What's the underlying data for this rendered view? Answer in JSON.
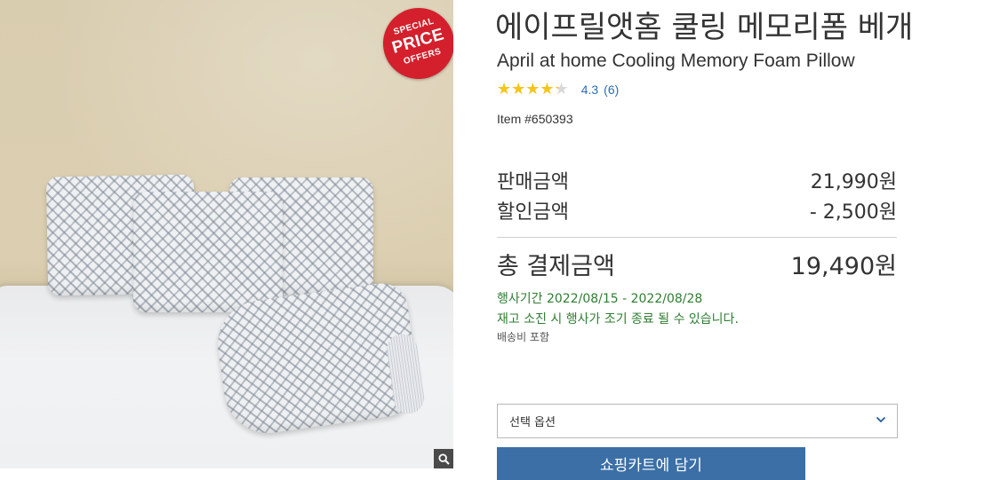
{
  "product": {
    "title_ko": "에이프릴앳홈 쿨링 메모리폼 베개",
    "title_en": "April at home Cooling Memory Foam Pillow",
    "rating_value": "4.3",
    "rating_fraction": 0.86,
    "review_count": "(6)",
    "item_number": "Item #650393",
    "image": {
      "badge": {
        "line1": "SPECIAL",
        "line2": "PRICE",
        "line3": "OFFERS"
      },
      "zoom_icon": "magnifier-icon"
    }
  },
  "price": {
    "sale_label": "판매금액",
    "sale_value": "21,990원",
    "discount_label": "할인금액",
    "discount_value": "- 2,500원",
    "total_label": "총 결제금액",
    "total_value": "19,490원"
  },
  "promo": {
    "period": "행사기간 2022/08/15 - 2022/08/28",
    "notice": "재고 소진 시 행사가 조기 종료 될 수 있습니다.",
    "shipping": "배송비 포함"
  },
  "option": {
    "selected": "선택 옵션",
    "chevron_icon": "chevron-down-icon"
  },
  "cart": {
    "button_label": "쇼핑카트에 담기"
  },
  "colors": {
    "accent": "#3b6fa6",
    "link": "#2a6fb5",
    "promo_green": "#2f7d32",
    "star": "#f5c518",
    "badge_red": "#d3202c"
  }
}
